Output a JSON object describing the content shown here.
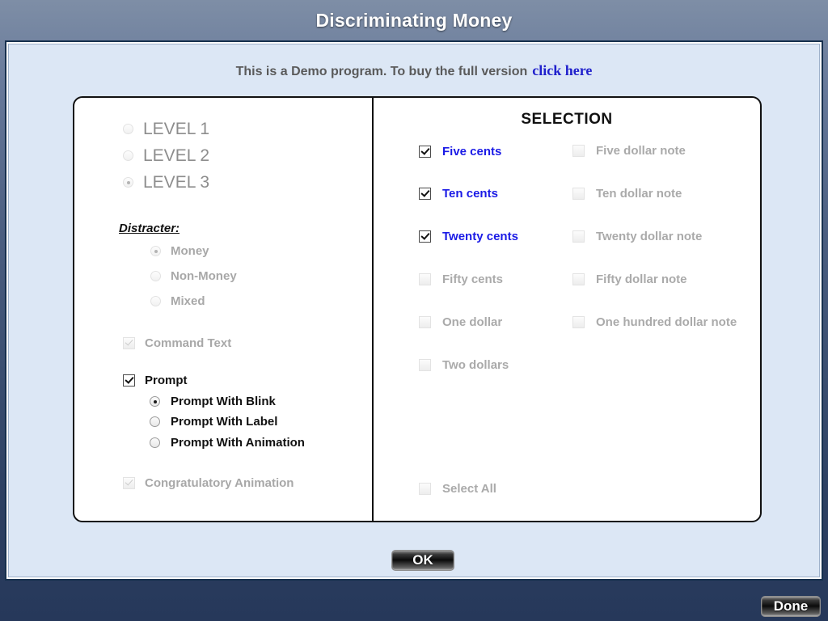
{
  "window": {
    "title": "Discriminating Money"
  },
  "banner": {
    "text": "This is a Demo program. To buy the full version",
    "link_label": "click here"
  },
  "levels": {
    "items": [
      {
        "label": "LEVEL 1",
        "selected": false,
        "enabled": false
      },
      {
        "label": "LEVEL 2",
        "selected": false,
        "enabled": false
      },
      {
        "label": "LEVEL 3",
        "selected": true,
        "enabled": false
      }
    ]
  },
  "distracter": {
    "heading": "Distracter:",
    "items": [
      {
        "label": "Money",
        "selected": true,
        "enabled": false
      },
      {
        "label": "Non-Money",
        "selected": false,
        "enabled": false
      },
      {
        "label": "Mixed",
        "selected": false,
        "enabled": false
      }
    ]
  },
  "options": {
    "command_text": {
      "label": "Command Text",
      "checked": true,
      "enabled": false
    },
    "prompt": {
      "label": "Prompt",
      "checked": true,
      "enabled": true
    },
    "prompt_modes": [
      {
        "label": "Prompt With Blink",
        "selected": true,
        "enabled": true
      },
      {
        "label": "Prompt With Label",
        "selected": false,
        "enabled": true
      },
      {
        "label": "Prompt With Animation",
        "selected": false,
        "enabled": true
      }
    ],
    "congratulatory": {
      "label": "Congratulatory Animation",
      "checked": true,
      "enabled": false
    }
  },
  "selection": {
    "title": "SELECTION",
    "coins": [
      {
        "label": "Five cents",
        "checked": true,
        "enabled": true
      },
      {
        "label": "Ten cents",
        "checked": true,
        "enabled": true
      },
      {
        "label": "Twenty cents",
        "checked": true,
        "enabled": true
      },
      {
        "label": "Fifty cents",
        "checked": false,
        "enabled": false
      },
      {
        "label": "One dollar",
        "checked": false,
        "enabled": false
      },
      {
        "label": "Two dollars",
        "checked": false,
        "enabled": false
      }
    ],
    "notes": [
      {
        "label": "Five dollar note",
        "checked": false,
        "enabled": false
      },
      {
        "label": "Ten dollar note",
        "checked": false,
        "enabled": false
      },
      {
        "label": "Twenty dollar note",
        "checked": false,
        "enabled": false
      },
      {
        "label": "Fifty dollar note",
        "checked": false,
        "enabled": false
      },
      {
        "label": "One hundred dollar note",
        "checked": false,
        "enabled": false
      }
    ],
    "select_all": {
      "label": "Select All",
      "checked": false,
      "enabled": false
    }
  },
  "buttons": {
    "ok": "OK",
    "done": "Done"
  },
  "colors": {
    "title_bar_dark": "#26385a",
    "content_bg": "#dce7f5",
    "link_blue": "#2020cc",
    "selected_blue": "#1a1ae6",
    "disabled_gray": "#a8a8a8"
  }
}
